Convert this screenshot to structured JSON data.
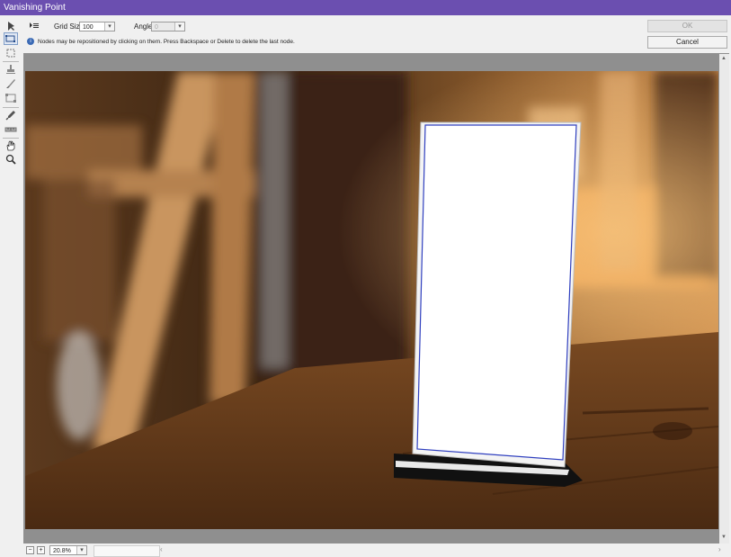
{
  "window": {
    "title": "Vanishing Point"
  },
  "toolbar": {
    "grid_label": "Grid Size:",
    "grid_value": "100",
    "angle_label": "Angle:",
    "angle_value": "0",
    "ok_label": "OK",
    "cancel_label": "Cancel"
  },
  "info": {
    "message": "Nodes may be repositioned by clicking on them.  Press Backspace or Delete to delete the last node."
  },
  "tools": [
    "edit-plane-tool",
    "create-plane-tool",
    "marquee-tool",
    "stamp-tool",
    "brush-tool",
    "transform-tool",
    "eyedropper-tool",
    "measure-tool",
    "hand-tool",
    "zoom-tool"
  ],
  "status": {
    "zoom": "20.8%"
  }
}
